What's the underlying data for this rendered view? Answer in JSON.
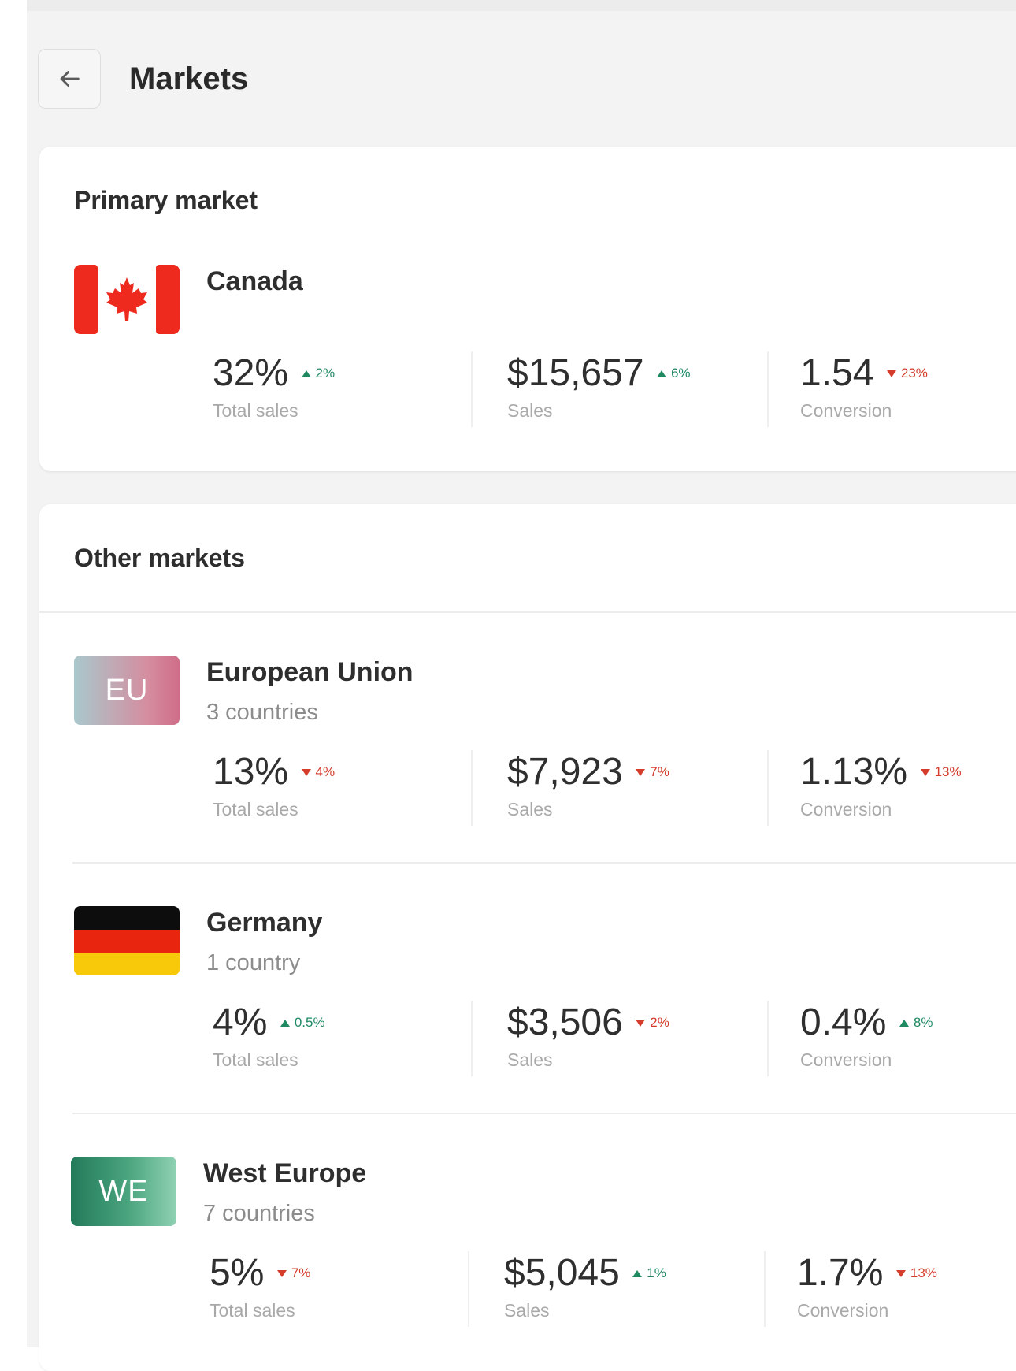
{
  "header": {
    "title": "Markets",
    "back_icon": "arrow-left-icon"
  },
  "primary": {
    "section_title": "Primary market",
    "market": {
      "name": "Canada",
      "flag": "canada-flag",
      "stats": [
        {
          "value": "32%",
          "trend": "up",
          "change": "2%",
          "label": "Total sales"
        },
        {
          "value": "$15,657",
          "trend": "up",
          "change": "6%",
          "label": "Sales"
        },
        {
          "value": "1.54",
          "trend": "down",
          "change": "23%",
          "label": "Conversion"
        }
      ]
    }
  },
  "other": {
    "section_title": "Other markets",
    "markets": [
      {
        "name": "European Union",
        "sub": "3 countries",
        "badge": "EU",
        "stats": [
          {
            "value": "13%",
            "trend": "down",
            "change": "4%",
            "label": "Total sales"
          },
          {
            "value": "$7,923",
            "trend": "down",
            "change": "7%",
            "label": "Sales"
          },
          {
            "value": "1.13%",
            "trend": "down",
            "change": "13%",
            "label": "Conversion"
          }
        ]
      },
      {
        "name": "Germany",
        "sub": "1 country",
        "flag": "germany-flag",
        "stats": [
          {
            "value": "4%",
            "trend": "up",
            "change": "0.5%",
            "label": "Total sales"
          },
          {
            "value": "$3,506",
            "trend": "down",
            "change": "2%",
            "label": "Sales"
          },
          {
            "value": "0.4%",
            "trend": "up",
            "change": "8%",
            "label": "Conversion"
          }
        ]
      },
      {
        "name": "West Europe",
        "sub": "7 countries",
        "badge": "WE",
        "stats": [
          {
            "value": "5%",
            "trend": "down",
            "change": "7%",
            "label": "Total sales"
          },
          {
            "value": "$5,045",
            "trend": "up",
            "change": "1%",
            "label": "Sales"
          },
          {
            "value": "1.7%",
            "trend": "down",
            "change": "13%",
            "label": "Conversion"
          }
        ]
      }
    ]
  },
  "colors": {
    "up": "#1f8a62",
    "down": "#d43d2c",
    "canada_red": "#ee2a1e"
  }
}
